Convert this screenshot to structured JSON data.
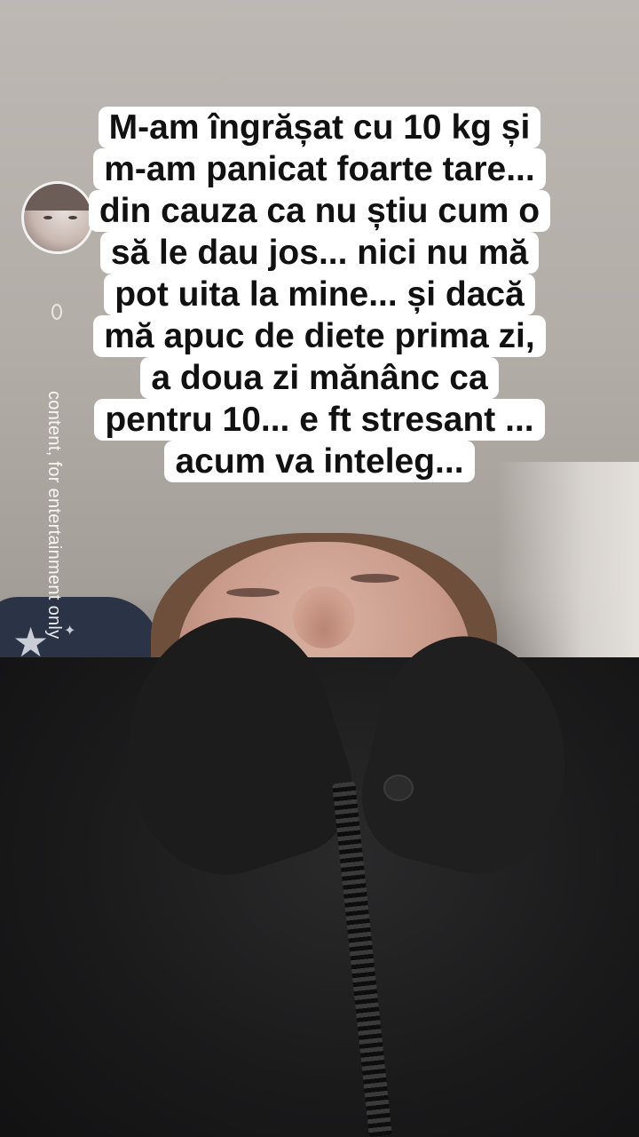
{
  "caption": {
    "lines": [
      "M-am îngrășat cu 10 kg și",
      "m-am panicat foarte tare...",
      "din cauza ca nu știu cum o",
      "să le dau jos... nici nu mă",
      "pot uita la mine... și dacă",
      "mă apuc de diete prima zi,",
      "a doua zi mănânc ca",
      "pentru 10... e ft stresant ...",
      "acum va inteleg..."
    ]
  },
  "disclaimer": {
    "text": "content, for entertainment only"
  },
  "icons": {
    "avatar": "profile-avatar",
    "pillow_pattern": "star-icon"
  }
}
